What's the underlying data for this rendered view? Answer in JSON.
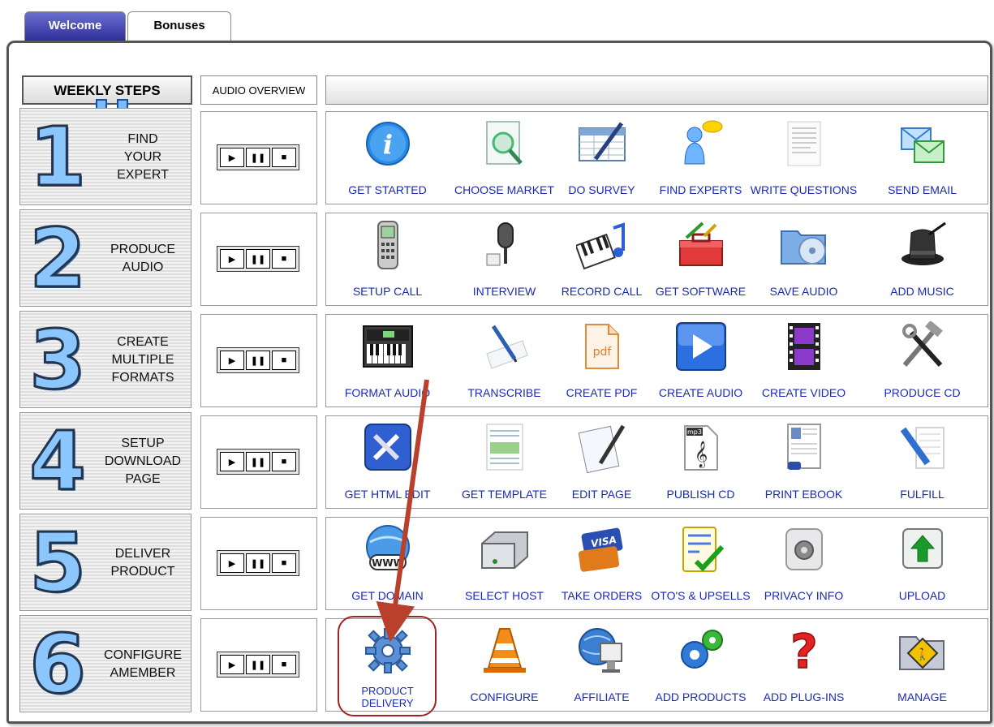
{
  "tabs": [
    {
      "label": "Welcome",
      "active": true
    },
    {
      "label": "Bonuses",
      "active": false
    }
  ],
  "header": {
    "weekly_steps": "WEEKLY STEPS",
    "audio_overview": "AUDIO OVERVIEW"
  },
  "player_controls": [
    {
      "icon": "play-icon",
      "glyph": "▶"
    },
    {
      "icon": "pause-icon",
      "glyph": "❚❚"
    },
    {
      "icon": "stop-icon",
      "glyph": "■"
    }
  ],
  "steps": [
    {
      "number": "1",
      "title": "FIND\nYOUR\nEXPERT",
      "items": [
        {
          "label": "GET STARTED",
          "icon": "info-icon"
        },
        {
          "label": "CHOOSE MARKET",
          "icon": "magnifier-document-icon"
        },
        {
          "label": "DO SURVEY",
          "icon": "spreadsheet-pencil-icon"
        },
        {
          "label": "FIND EXPERTS",
          "icon": "person-chat-icon"
        },
        {
          "label": "WRITE QUESTIONS",
          "icon": "text-document-icon"
        },
        {
          "label": "SEND EMAIL",
          "icon": "envelopes-icon"
        }
      ]
    },
    {
      "number": "2",
      "title": "PRODUCE\nAUDIO",
      "items": [
        {
          "label": "SETUP CALL",
          "icon": "mobile-phone-icon"
        },
        {
          "label": "INTERVIEW",
          "icon": "microphone-icon"
        },
        {
          "label": "RECORD CALL",
          "icon": "piano-music-icon"
        },
        {
          "label": "GET SOFTWARE",
          "icon": "toolbox-icon"
        },
        {
          "label": "SAVE AUDIO",
          "icon": "folder-disc-icon"
        },
        {
          "label": "ADD MUSIC",
          "icon": "magic-hat-icon"
        }
      ]
    },
    {
      "number": "3",
      "title": "CREATE\nMULTIPLE\nFORMATS",
      "items": [
        {
          "label": "FORMAT AUDIO",
          "icon": "keyboard-synth-icon"
        },
        {
          "label": "TRANSCRIBE",
          "icon": "pen-paper-icon"
        },
        {
          "label": "CREATE PDF",
          "icon": "pdf-file-icon"
        },
        {
          "label": "CREATE AUDIO",
          "icon": "play-button-icon"
        },
        {
          "label": "CREATE VIDEO",
          "icon": "film-strip-icon"
        },
        {
          "label": "PRODUCE CD",
          "icon": "hammer-wrench-icon"
        }
      ]
    },
    {
      "number": "4",
      "title": "SETUP\nDOWNLOAD\nPAGE",
      "items": [
        {
          "label": "GET HTML EDIT",
          "icon": "tools-app-icon"
        },
        {
          "label": "GET TEMPLATE",
          "icon": "web-template-icon"
        },
        {
          "label": "EDIT PAGE",
          "icon": "document-pen-icon"
        },
        {
          "label": "PUBLISH CD",
          "icon": "mp3-file-icon"
        },
        {
          "label": "PRINT EBOOK",
          "icon": "pdf-ebook-icon"
        },
        {
          "label": "FULFILL",
          "icon": "document-pencil-icon"
        }
      ]
    },
    {
      "number": "5",
      "title": "DELIVER\nPRODUCT",
      "items": [
        {
          "label": "GET DOMAIN",
          "icon": "www-globe-icon"
        },
        {
          "label": "SELECT HOST",
          "icon": "hard-drive-icon"
        },
        {
          "label": "TAKE ORDERS",
          "icon": "credit-cards-icon"
        },
        {
          "label": "OTO'S & UPSELLS",
          "icon": "checklist-icon"
        },
        {
          "label": "PRIVACY INFO",
          "icon": "lock-icon"
        },
        {
          "label": "UPLOAD",
          "icon": "upload-arrow-icon"
        }
      ]
    },
    {
      "number": "6",
      "title": "CONFIGURE\nAMEMBER",
      "items": [
        {
          "label": "PRODUCT\nDELIVERY",
          "icon": "gear-icon"
        },
        {
          "label": "CONFIGURE",
          "icon": "traffic-cone-icon"
        },
        {
          "label": "AFFILIATE",
          "icon": "globe-computer-icon"
        },
        {
          "label": "ADD PRODUCTS",
          "icon": "gears-icon"
        },
        {
          "label": "ADD PLUG-INS",
          "icon": "question-mark-icon"
        },
        {
          "label": "MANAGE",
          "icon": "folder-sign-icon"
        }
      ]
    }
  ],
  "colors": {
    "link": "#1a2ab8",
    "tab_active": "#3a3aa8",
    "highlight": "#a02323",
    "step_number_fill": "#8cc6ff"
  }
}
